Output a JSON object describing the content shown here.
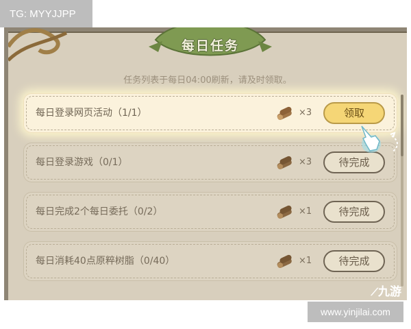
{
  "overlay": {
    "tg_label": "TG: MYYJJPP",
    "url": "www.yinjilai.com",
    "logo": "九游"
  },
  "dialog": {
    "title": "每日任务",
    "subtitle": "任务列表于每日04:00刷新，请及时领取。"
  },
  "tasks": [
    {
      "name": "每日登录网页活动（1/1）",
      "reward_icon": "wood-icon",
      "count": "×3",
      "button": "领取",
      "state": "claimable"
    },
    {
      "name": "每日登录游戏（0/1）",
      "reward_icon": "wood-icon",
      "count": "×3",
      "button": "待完成",
      "state": "pending"
    },
    {
      "name": "每日完成2个每日委托（0/2）",
      "reward_icon": "wood-icon",
      "count": "×1",
      "button": "待完成",
      "state": "pending"
    },
    {
      "name": "每日消耗40点原粹树脂（0/40）",
      "reward_icon": "wood-icon",
      "count": "×1",
      "button": "待完成",
      "state": "pending"
    }
  ],
  "colors": {
    "panel_bg": "#d8cfbd",
    "claim_button": "#f5d676",
    "title_leaf": "#7f9a52"
  }
}
